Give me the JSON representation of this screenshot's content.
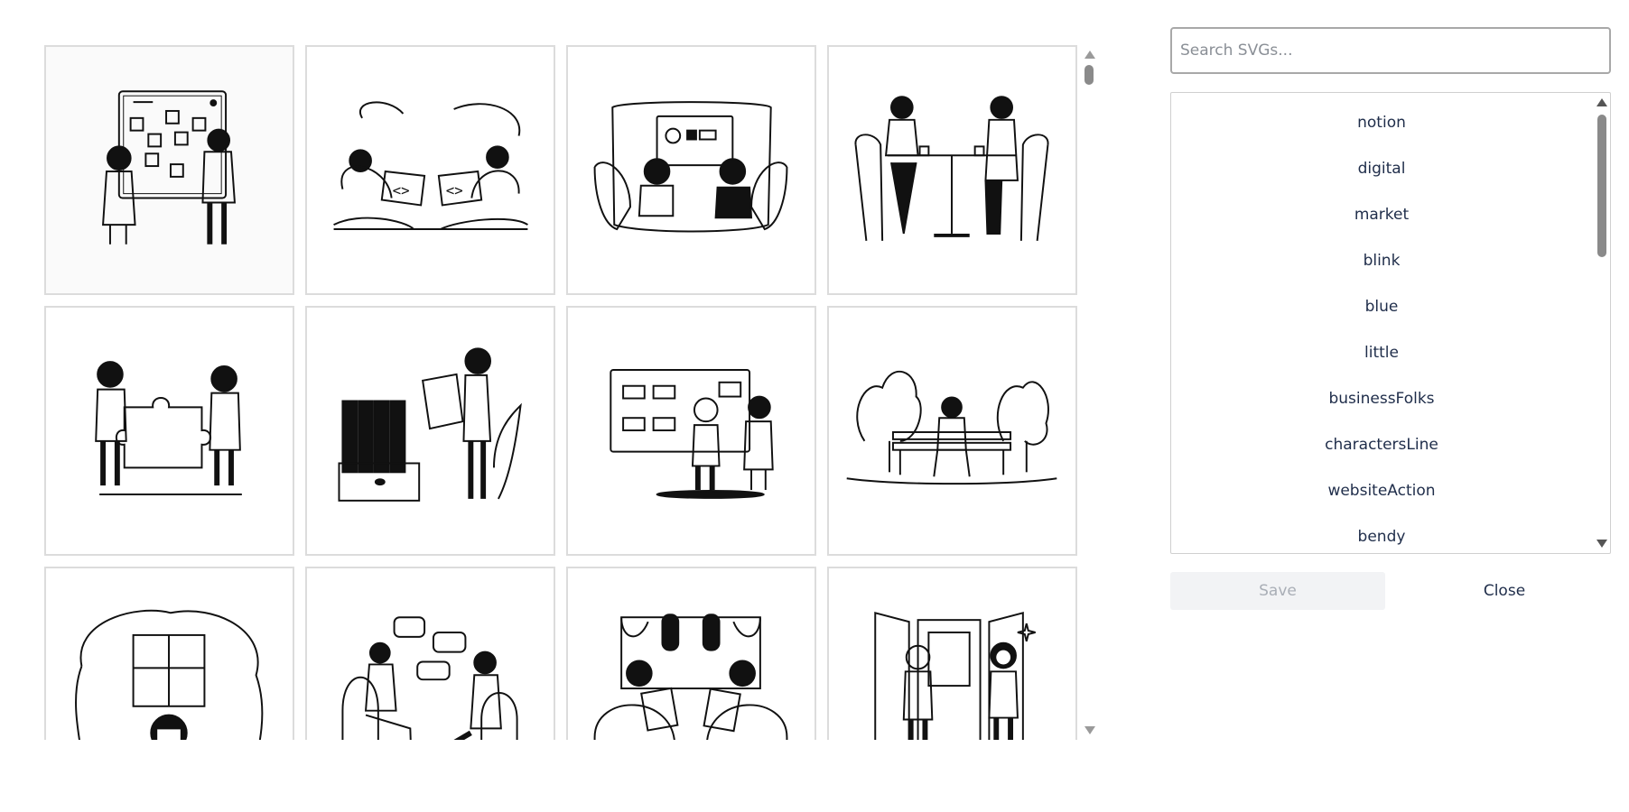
{
  "gallery": {
    "tiles": [
      {
        "icon": "kanban-board-illustration"
      },
      {
        "icon": "coders-laptops-illustration"
      },
      {
        "icon": "couch-presentation-illustration"
      },
      {
        "icon": "cafe-table-illustration"
      },
      {
        "icon": "puzzle-piece-illustration"
      },
      {
        "icon": "file-binders-illustration"
      },
      {
        "icon": "whiteboard-kids-illustration"
      },
      {
        "icon": "park-bench-illustration"
      },
      {
        "icon": "window-thinking-illustration"
      },
      {
        "icon": "chat-bubbles-illustration"
      },
      {
        "icon": "armchair-reading-illustration"
      },
      {
        "icon": "door-wave-illustration"
      }
    ]
  },
  "search": {
    "placeholder": "Search SVGs..."
  },
  "list": {
    "items": [
      "notion",
      "digital",
      "market",
      "blink",
      "blue",
      "little",
      "businessFolks",
      "charactersLine",
      "websiteAction",
      "bendy"
    ]
  },
  "actions": {
    "save_label": "Save",
    "close_label": "Close"
  }
}
